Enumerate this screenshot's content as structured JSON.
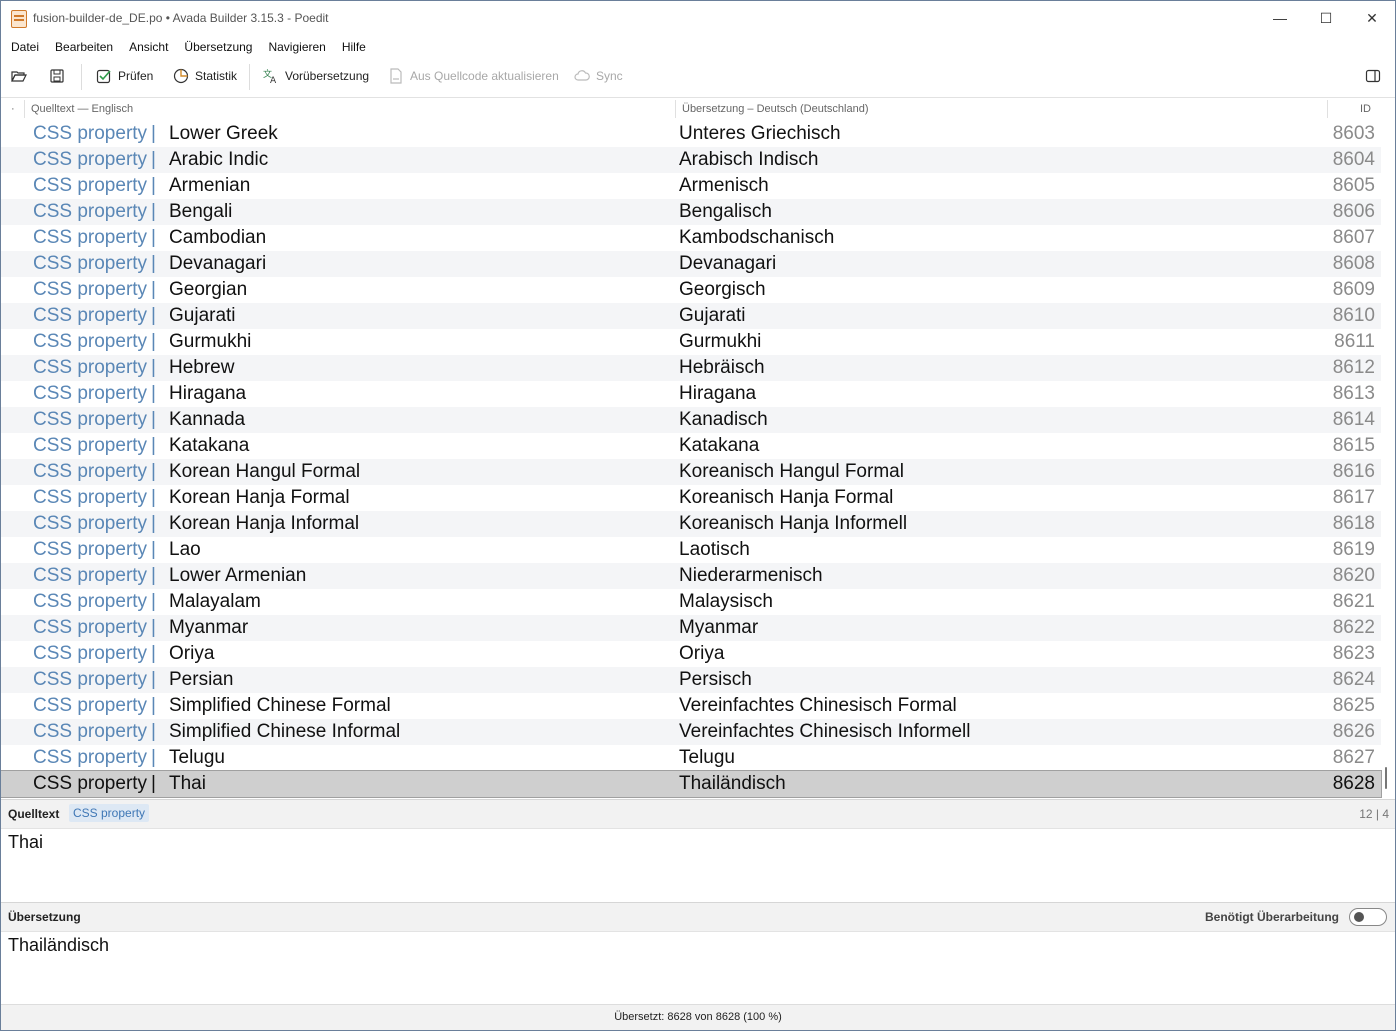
{
  "window": {
    "title": "fusion-builder-de_DE.po • Avada Builder 3.15.3 - Poedit",
    "minimize": "—",
    "maximize": "☐",
    "close": "✕"
  },
  "menu": [
    "Datei",
    "Bearbeiten",
    "Ansicht",
    "Übersetzung",
    "Navigieren",
    "Hilfe"
  ],
  "toolbar": {
    "check": "Prüfen",
    "stats": "Statistik",
    "pretranslate": "Vorübersetzung",
    "update": "Aus Quellcode aktualisieren",
    "sync": "Sync"
  },
  "columns": {
    "dot": "·",
    "source": "Quelltext — Englisch",
    "translation": "Übersetzung – Deutsch (Deutschland)",
    "id": "ID"
  },
  "context_label": "CSS property",
  "rows": [
    {
      "src": "Lower Greek",
      "tr": "Unteres Griechisch",
      "id": "8603"
    },
    {
      "src": "Arabic Indic",
      "tr": "Arabisch Indisch",
      "id": "8604"
    },
    {
      "src": "Armenian",
      "tr": "Armenisch",
      "id": "8605"
    },
    {
      "src": "Bengali",
      "tr": "Bengalisch",
      "id": "8606"
    },
    {
      "src": "Cambodian",
      "tr": "Kambodschanisch",
      "id": "8607"
    },
    {
      "src": "Devanagari",
      "tr": "Devanagari",
      "id": "8608"
    },
    {
      "src": "Georgian",
      "tr": "Georgisch",
      "id": "8609"
    },
    {
      "src": "Gujarati",
      "tr": "Gujarati",
      "id": "8610"
    },
    {
      "src": "Gurmukhi",
      "tr": "Gurmukhi",
      "id": "8611"
    },
    {
      "src": "Hebrew",
      "tr": "Hebräisch",
      "id": "8612"
    },
    {
      "src": "Hiragana",
      "tr": "Hiragana",
      "id": "8613"
    },
    {
      "src": "Kannada",
      "tr": "Kanadisch",
      "id": "8614"
    },
    {
      "src": "Katakana",
      "tr": "Katakana",
      "id": "8615"
    },
    {
      "src": "Korean Hangul Formal",
      "tr": "Koreanisch Hangul Formal",
      "id": "8616"
    },
    {
      "src": "Korean Hanja Formal",
      "tr": "Koreanisch Hanja Formal",
      "id": "8617"
    },
    {
      "src": "Korean Hanja Informal",
      "tr": "Koreanisch Hanja Informell",
      "id": "8618"
    },
    {
      "src": "Lao",
      "tr": "Laotisch",
      "id": "8619"
    },
    {
      "src": "Lower Armenian",
      "tr": "Niederarmenisch",
      "id": "8620"
    },
    {
      "src": "Malayalam",
      "tr": "Malaysisch",
      "id": "8621"
    },
    {
      "src": "Myanmar",
      "tr": "Myanmar",
      "id": "8622"
    },
    {
      "src": "Oriya",
      "tr": "Oriya",
      "id": "8623"
    },
    {
      "src": "Persian",
      "tr": "Persisch",
      "id": "8624"
    },
    {
      "src": "Simplified Chinese Formal",
      "tr": "Vereinfachtes Chinesisch Formal",
      "id": "8625"
    },
    {
      "src": "Simplified Chinese Informal",
      "tr": "Vereinfachtes Chinesisch Informell",
      "id": "8626"
    },
    {
      "src": "Telugu",
      "tr": "Telugu",
      "id": "8627"
    },
    {
      "src": "Thai",
      "tr": "Thailändisch",
      "id": "8628",
      "selected": true
    }
  ],
  "source_pane": {
    "label": "Quelltext",
    "context": "CSS property",
    "counts": "12 | 4",
    "text": "Thai"
  },
  "translation_pane": {
    "label": "Übersetzung",
    "fuzzy_label": "Benötigt Überarbeitung",
    "fuzzy_on": false,
    "text": "Thailändisch"
  },
  "status": "Übersetzt: 8628 von 8628 (100 %)"
}
